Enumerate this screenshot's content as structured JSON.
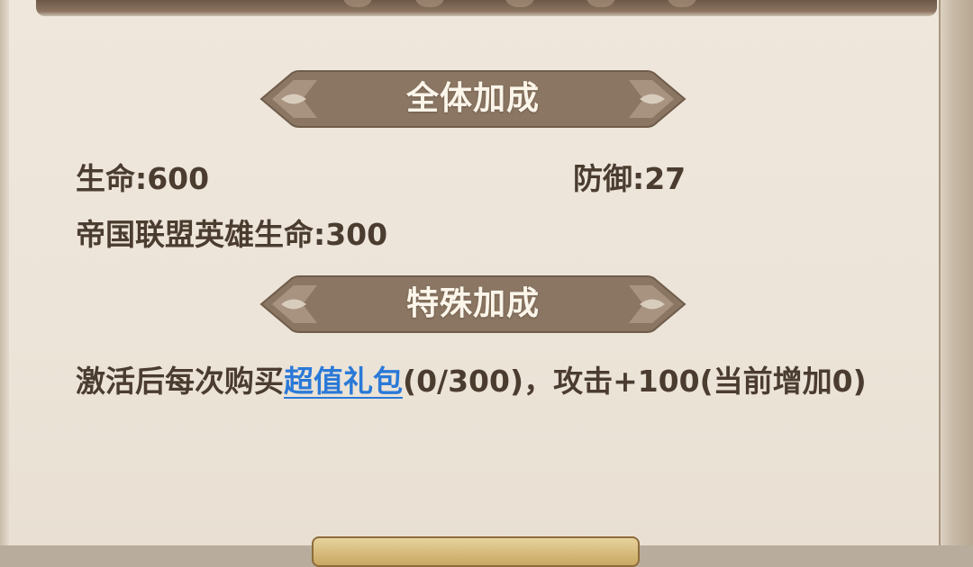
{
  "sections": {
    "overall": {
      "title": "全体加成",
      "hp": "生命:600",
      "defense": "防御:27",
      "empire_hp": "帝国联盟英雄生命:300"
    },
    "special": {
      "title": "特殊加成",
      "text_before": "激活后每次购买",
      "link": "超值礼包",
      "text_after": "(0/300)，攻击+100(当前增加0)"
    }
  },
  "colors": {
    "banner": "#8a7663",
    "text": "#4b3c30",
    "link": "#2a79d8",
    "panel": "#ece4d8"
  }
}
